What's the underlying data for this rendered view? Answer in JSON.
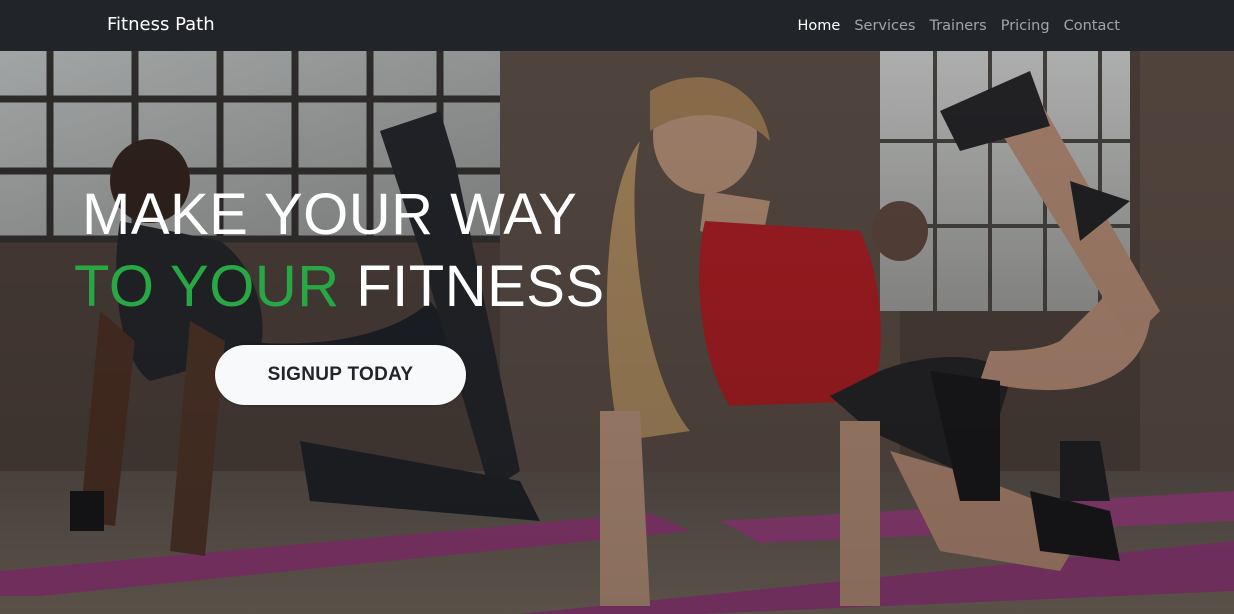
{
  "navbar": {
    "brand": "Fitness Path",
    "links": [
      {
        "label": "Home",
        "active": true
      },
      {
        "label": "Services",
        "active": false
      },
      {
        "label": "Trainers",
        "active": false
      },
      {
        "label": "Pricing",
        "active": false
      },
      {
        "label": "Contact",
        "active": false
      }
    ]
  },
  "hero": {
    "title_line1": "MAKE YOUR WAY",
    "title_line2_accent": "TO YOUR",
    "title_line2_rest": " FITNESS",
    "cta_label": "SIGNUP TODAY"
  },
  "colors": {
    "navbar_bg": "#212529",
    "accent_green": "#28a745",
    "button_bg": "#f8f9fa",
    "mat_pink": "#b0468f"
  }
}
